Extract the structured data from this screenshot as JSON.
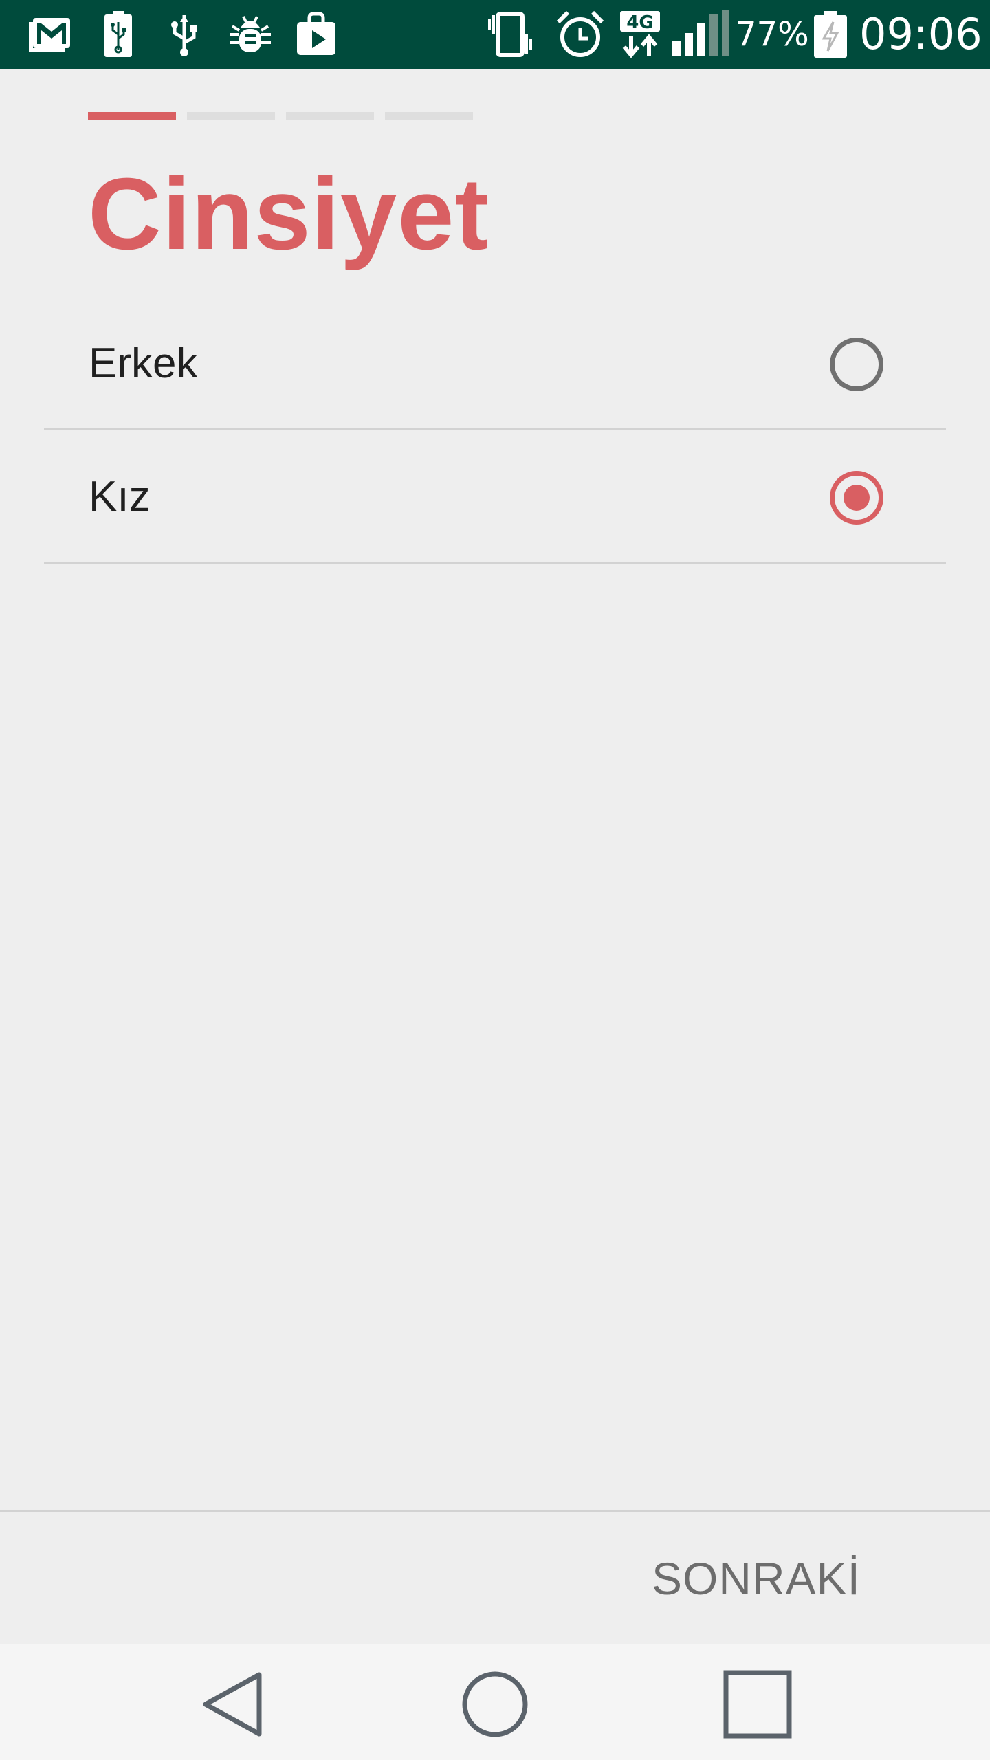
{
  "status_bar": {
    "left_icons": [
      "gmail-icon",
      "battery-usb-icon",
      "usb-icon",
      "debug-bug-icon",
      "play-store-icon"
    ],
    "right_icons": [
      "vibrate-icon",
      "alarm-icon",
      "network-4g-icon",
      "signal-strength-icon",
      "battery-charging-icon"
    ],
    "network_label": "4G",
    "battery_percent": "77%",
    "time": "09:06"
  },
  "stepper": {
    "total_steps": 4,
    "current_step": 1
  },
  "title": "Cinsiyet",
  "options": [
    {
      "label": "Erkek",
      "selected": false
    },
    {
      "label": "Kız",
      "selected": true
    }
  ],
  "footer": {
    "next_label": "SONRAKİ"
  },
  "nav_bar": {
    "buttons": [
      "back",
      "home",
      "recents"
    ]
  },
  "colors": {
    "accent": "#d95f62",
    "status_bar": "#004b3c",
    "background": "#eeeeee",
    "nav_bar": "#f5f5f5"
  }
}
